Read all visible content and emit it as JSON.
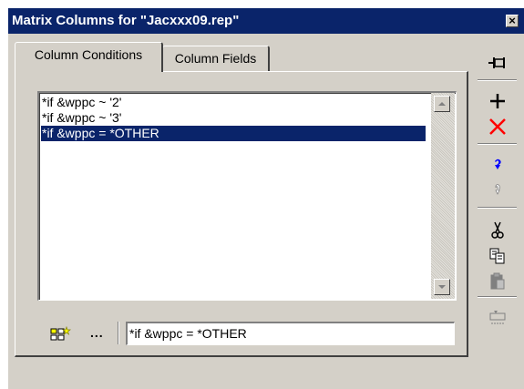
{
  "window": {
    "title": "Matrix Columns for \"Jacxxx09.rep\"",
    "close_label": "×"
  },
  "tabs": [
    {
      "label": "Column Conditions",
      "active": true
    },
    {
      "label": "Column Fields",
      "active": false
    }
  ],
  "conditions": {
    "items": [
      "*if &wppc ~ '2'",
      "*if &wppc ~ '3'",
      "*if &wppc = *OTHER"
    ],
    "selected_index": 2
  },
  "editor": {
    "ellipsis_label": "...",
    "expression_value": "*if &wppc = *OTHER"
  },
  "toolbar": {
    "buttons": [
      {
        "name": "pin-icon",
        "enabled": true
      },
      {
        "name": "add-icon",
        "enabled": true
      },
      {
        "name": "delete-icon",
        "enabled": true
      },
      {
        "name": "move-up-icon",
        "enabled": true
      },
      {
        "name": "move-down-icon",
        "enabled": false
      },
      {
        "name": "cut-icon",
        "enabled": true
      },
      {
        "name": "copy-icon",
        "enabled": true
      },
      {
        "name": "paste-icon",
        "enabled": false
      },
      {
        "name": "rename-icon",
        "enabled": false
      }
    ]
  },
  "colors": {
    "titlebar": "#0a246a",
    "selection": "#0a246a",
    "face": "#d4d0c8",
    "delete_red": "#ff0000",
    "arrow_blue": "#0000ff"
  }
}
